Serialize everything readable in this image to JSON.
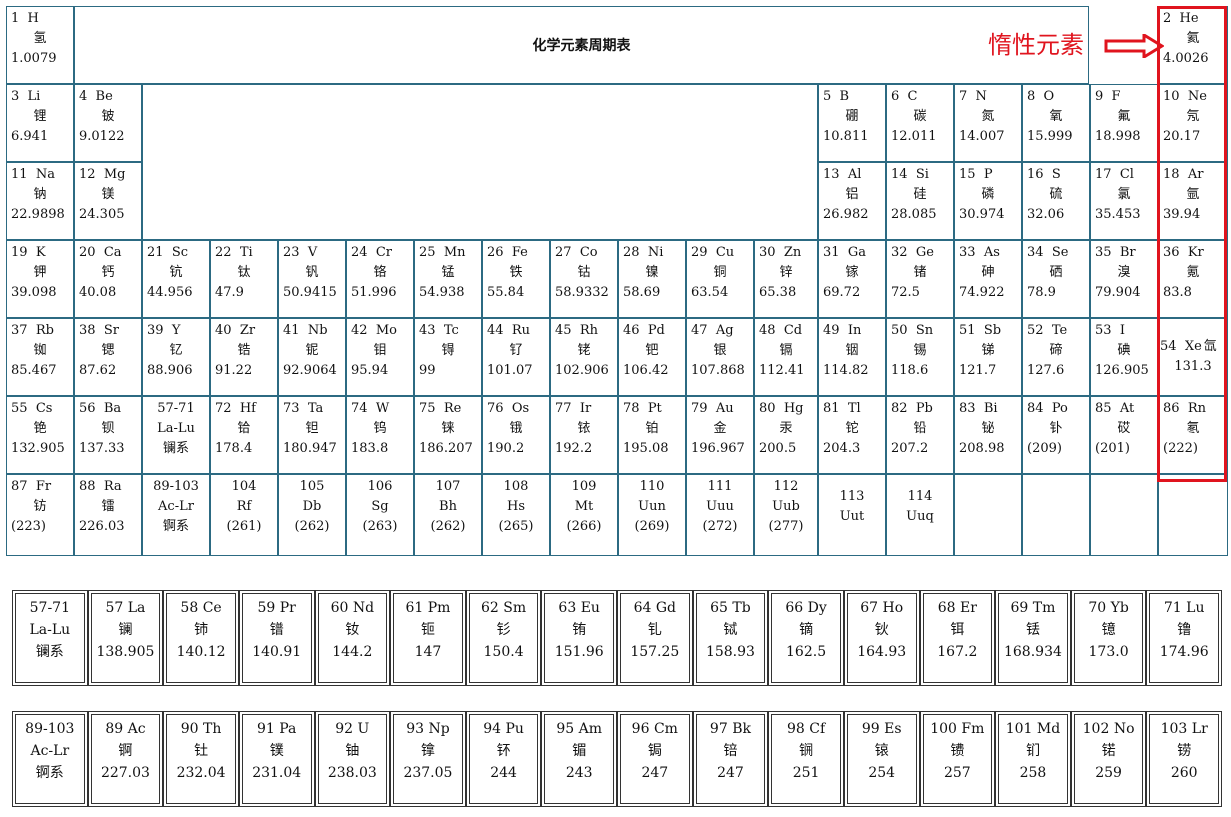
{
  "title": "化学元素周期表",
  "annotation": {
    "text": "惰性元素",
    "color": "#e0141e"
  },
  "main": [
    {
      "r": 0,
      "c": 0,
      "n": "1",
      "s": "H",
      "cn": "氢",
      "m": "1.0079"
    },
    {
      "r": 0,
      "c": 17,
      "n": "2",
      "s": "He",
      "cn": "氦",
      "m": "4.0026"
    },
    {
      "r": 1,
      "c": 0,
      "n": "3",
      "s": "Li",
      "cn": "锂",
      "m": "6.941"
    },
    {
      "r": 1,
      "c": 1,
      "n": "4",
      "s": "Be",
      "cn": "铍",
      "m": "9.0122"
    },
    {
      "r": 1,
      "c": 12,
      "n": "5",
      "s": "B",
      "cn": "硼",
      "m": "10.811"
    },
    {
      "r": 1,
      "c": 13,
      "n": "6",
      "s": "C",
      "cn": "碳",
      "m": "12.011"
    },
    {
      "r": 1,
      "c": 14,
      "n": "7",
      "s": "N",
      "cn": "氮",
      "m": "14.007"
    },
    {
      "r": 1,
      "c": 15,
      "n": "8",
      "s": "O",
      "cn": "氧",
      "m": "15.999"
    },
    {
      "r": 1,
      "c": 16,
      "n": "9",
      "s": "F",
      "cn": "氟",
      "m": "18.998"
    },
    {
      "r": 1,
      "c": 17,
      "n": "10",
      "s": "Ne",
      "cn": "氖",
      "m": "20.17"
    },
    {
      "r": 2,
      "c": 0,
      "n": "11",
      "s": "Na",
      "cn": "钠",
      "m": "22.9898"
    },
    {
      "r": 2,
      "c": 1,
      "n": "12",
      "s": "Mg",
      "cn": "镁",
      "m": "24.305"
    },
    {
      "r": 2,
      "c": 12,
      "n": "13",
      "s": "Al",
      "cn": "铝",
      "m": "26.982"
    },
    {
      "r": 2,
      "c": 13,
      "n": "14",
      "s": "Si",
      "cn": "硅",
      "m": "28.085"
    },
    {
      "r": 2,
      "c": 14,
      "n": "15",
      "s": "P",
      "cn": "磷",
      "m": "30.974"
    },
    {
      "r": 2,
      "c": 15,
      "n": "16",
      "s": "S",
      "cn": "硫",
      "m": "32.06"
    },
    {
      "r": 2,
      "c": 16,
      "n": "17",
      "s": "Cl",
      "cn": "氯",
      "m": "35.453"
    },
    {
      "r": 2,
      "c": 17,
      "n": "18",
      "s": "Ar",
      "cn": "氩",
      "m": "39.94"
    },
    {
      "r": 3,
      "c": 0,
      "n": "19",
      "s": "K",
      "cn": "钾",
      "m": "39.098"
    },
    {
      "r": 3,
      "c": 1,
      "n": "20",
      "s": "Ca",
      "cn": "钙",
      "m": "40.08"
    },
    {
      "r": 3,
      "c": 2,
      "n": "21",
      "s": "Sc",
      "cn": "钪",
      "m": "44.956"
    },
    {
      "r": 3,
      "c": 3,
      "n": "22",
      "s": "Ti",
      "cn": "钛",
      "m": "47.9"
    },
    {
      "r": 3,
      "c": 4,
      "n": "23",
      "s": "V",
      "cn": "钒",
      "m": "50.9415"
    },
    {
      "r": 3,
      "c": 5,
      "n": "24",
      "s": "Cr",
      "cn": "铬",
      "m": "51.996"
    },
    {
      "r": 3,
      "c": 6,
      "n": "25",
      "s": "Mn",
      "cn": "锰",
      "m": "54.938"
    },
    {
      "r": 3,
      "c": 7,
      "n": "26",
      "s": "Fe",
      "cn": "铁",
      "m": "55.84"
    },
    {
      "r": 3,
      "c": 8,
      "n": "27",
      "s": "Co",
      "cn": "钴",
      "m": "58.9332"
    },
    {
      "r": 3,
      "c": 9,
      "n": "28",
      "s": "Ni",
      "cn": "镍",
      "m": "58.69"
    },
    {
      "r": 3,
      "c": 10,
      "n": "29",
      "s": "Cu",
      "cn": "铜",
      "m": "63.54"
    },
    {
      "r": 3,
      "c": 11,
      "n": "30",
      "s": "Zn",
      "cn": "锌",
      "m": "65.38"
    },
    {
      "r": 3,
      "c": 12,
      "n": "31",
      "s": "Ga",
      "cn": "镓",
      "m": "69.72"
    },
    {
      "r": 3,
      "c": 13,
      "n": "32",
      "s": "Ge",
      "cn": "锗",
      "m": "72.5"
    },
    {
      "r": 3,
      "c": 14,
      "n": "33",
      "s": "As",
      "cn": "砷",
      "m": "74.922"
    },
    {
      "r": 3,
      "c": 15,
      "n": "34",
      "s": "Se",
      "cn": "硒",
      "m": "78.9"
    },
    {
      "r": 3,
      "c": 16,
      "n": "35",
      "s": "Br",
      "cn": "溴",
      "m": "79.904"
    },
    {
      "r": 3,
      "c": 17,
      "n": "36",
      "s": "Kr",
      "cn": "氪",
      "m": "83.8"
    },
    {
      "r": 4,
      "c": 0,
      "n": "37",
      "s": "Rb",
      "cn": "铷",
      "m": "85.467"
    },
    {
      "r": 4,
      "c": 1,
      "n": "38",
      "s": "Sr",
      "cn": "锶",
      "m": "87.62"
    },
    {
      "r": 4,
      "c": 2,
      "n": "39",
      "s": "Y",
      "cn": "钇",
      "m": "88.906"
    },
    {
      "r": 4,
      "c": 3,
      "n": "40",
      "s": "Zr",
      "cn": "锆",
      "m": "91.22"
    },
    {
      "r": 4,
      "c": 4,
      "n": "41",
      "s": "Nb",
      "cn": "铌",
      "m": "92.9064"
    },
    {
      "r": 4,
      "c": 5,
      "n": "42",
      "s": "Mo",
      "cn": "钼",
      "m": "95.94"
    },
    {
      "r": 4,
      "c": 6,
      "n": "43",
      "s": "Tc",
      "cn": "锝",
      "m": "99"
    },
    {
      "r": 4,
      "c": 7,
      "n": "44",
      "s": "Ru",
      "cn": "钌",
      "m": "101.07"
    },
    {
      "r": 4,
      "c": 8,
      "n": "45",
      "s": "Rh",
      "cn": "铑",
      "m": "102.906"
    },
    {
      "r": 4,
      "c": 9,
      "n": "46",
      "s": "Pd",
      "cn": "钯",
      "m": "106.42"
    },
    {
      "r": 4,
      "c": 10,
      "n": "47",
      "s": "Ag",
      "cn": "银",
      "m": "107.868"
    },
    {
      "r": 4,
      "c": 11,
      "n": "48",
      "s": "Cd",
      "cn": "镉",
      "m": "112.41"
    },
    {
      "r": 4,
      "c": 12,
      "n": "49",
      "s": "In",
      "cn": "铟",
      "m": "114.82"
    },
    {
      "r": 4,
      "c": 13,
      "n": "50",
      "s": "Sn",
      "cn": "锡",
      "m": "118.6"
    },
    {
      "r": 4,
      "c": 14,
      "n": "51",
      "s": "Sb",
      "cn": "锑",
      "m": "121.7"
    },
    {
      "r": 4,
      "c": 15,
      "n": "52",
      "s": "Te",
      "cn": "碲",
      "m": "127.6"
    },
    {
      "r": 4,
      "c": 16,
      "n": "53",
      "s": "I",
      "cn": "碘",
      "m": "126.905"
    },
    {
      "r": 4,
      "c": 17,
      "n": "54",
      "s": "Xe",
      "cn": "氙",
      "m": "131.3",
      "xe": true
    },
    {
      "r": 5,
      "c": 0,
      "n": "55",
      "s": "Cs",
      "cn": "铯",
      "m": "132.905"
    },
    {
      "r": 5,
      "c": 1,
      "n": "56",
      "s": "Ba",
      "cn": "钡",
      "m": "137.33"
    },
    {
      "r": 5,
      "c": 2,
      "n": "57-71",
      "s": "",
      "cn": "La-Lu",
      "m": "镧系"
    },
    {
      "r": 5,
      "c": 3,
      "n": "72",
      "s": "Hf",
      "cn": "铪",
      "m": "178.4"
    },
    {
      "r": 5,
      "c": 4,
      "n": "73",
      "s": "Ta",
      "cn": "钽",
      "m": "180.947"
    },
    {
      "r": 5,
      "c": 5,
      "n": "74",
      "s": "W",
      "cn": "钨",
      "m": "183.8"
    },
    {
      "r": 5,
      "c": 6,
      "n": "75",
      "s": "Re",
      "cn": "铼",
      "m": "186.207"
    },
    {
      "r": 5,
      "c": 7,
      "n": "76",
      "s": "Os",
      "cn": "锇",
      "m": "190.2"
    },
    {
      "r": 5,
      "c": 8,
      "n": "77",
      "s": "Ir",
      "cn": "铱",
      "m": "192.2"
    },
    {
      "r": 5,
      "c": 9,
      "n": "78",
      "s": "Pt",
      "cn": "铂",
      "m": "195.08"
    },
    {
      "r": 5,
      "c": 10,
      "n": "79",
      "s": "Au",
      "cn": "金",
      "m": "196.967"
    },
    {
      "r": 5,
      "c": 11,
      "n": "80",
      "s": "Hg",
      "cn": "汞",
      "m": "200.5"
    },
    {
      "r": 5,
      "c": 12,
      "n": "81",
      "s": "Tl",
      "cn": "铊",
      "m": "204.3"
    },
    {
      "r": 5,
      "c": 13,
      "n": "82",
      "s": "Pb",
      "cn": "铅",
      "m": "207.2"
    },
    {
      "r": 5,
      "c": 14,
      "n": "83",
      "s": "Bi",
      "cn": "铋",
      "m": "208.98"
    },
    {
      "r": 5,
      "c": 15,
      "n": "84",
      "s": "Po",
      "cn": "钋",
      "m": "(209)"
    },
    {
      "r": 5,
      "c": 16,
      "n": "85",
      "s": "At",
      "cn": "砹",
      "m": "(201)"
    },
    {
      "r": 5,
      "c": 17,
      "n": "86",
      "s": "Rn",
      "cn": "氡",
      "m": "(222)"
    },
    {
      "r": 6,
      "c": 0,
      "n": "87",
      "s": "Fr",
      "cn": "钫",
      "m": "(223)"
    },
    {
      "r": 6,
      "c": 1,
      "n": "88",
      "s": "Ra",
      "cn": "镭",
      "m": "226.03"
    },
    {
      "r": 6,
      "c": 2,
      "n": "89-103",
      "s": "",
      "cn": "Ac-Lr",
      "m": "锕系"
    },
    {
      "r": 6,
      "c": 3,
      "n": "104",
      "s": "",
      "cn": "Rf",
      "m": "(261)"
    },
    {
      "r": 6,
      "c": 4,
      "n": "105",
      "s": "",
      "cn": "Db",
      "m": "(262)"
    },
    {
      "r": 6,
      "c": 5,
      "n": "106",
      "s": "",
      "cn": "Sg",
      "m": "(263)"
    },
    {
      "r": 6,
      "c": 6,
      "n": "107",
      "s": "",
      "cn": "Bh",
      "m": "(262)"
    },
    {
      "r": 6,
      "c": 7,
      "n": "108",
      "s": "",
      "cn": "Hs",
      "m": "(265)"
    },
    {
      "r": 6,
      "c": 8,
      "n": "109",
      "s": "",
      "cn": "Mt",
      "m": "(266)"
    },
    {
      "r": 6,
      "c": 9,
      "n": "110",
      "s": "",
      "cn": "Uun",
      "m": "(269)"
    },
    {
      "r": 6,
      "c": 10,
      "n": "111",
      "s": "",
      "cn": "Uuu",
      "m": "(272)"
    },
    {
      "r": 6,
      "c": 11,
      "n": "112",
      "s": "",
      "cn": "Uub",
      "m": "(277)"
    },
    {
      "r": 6,
      "c": 12,
      "n": "113",
      "s": "",
      "cn": "Uut",
      "m": ""
    },
    {
      "r": 6,
      "c": 13,
      "n": "114",
      "s": "",
      "cn": "Uuq",
      "m": ""
    }
  ],
  "lanthanides": [
    {
      "n": "57-71",
      "s": "",
      "cn": "La-Lu",
      "m": "镧系"
    },
    {
      "n": "57",
      "s": "La",
      "cn": "镧",
      "m": "138.905"
    },
    {
      "n": "58",
      "s": "Ce",
      "cn": "铈",
      "m": "140.12"
    },
    {
      "n": "59",
      "s": "Pr",
      "cn": "镨",
      "m": "140.91"
    },
    {
      "n": "60",
      "s": "Nd",
      "cn": "钕",
      "m": "144.2"
    },
    {
      "n": "61",
      "s": "Pm",
      "cn": "钷",
      "m": "147"
    },
    {
      "n": "62",
      "s": "Sm",
      "cn": "钐",
      "m": "150.4"
    },
    {
      "n": "63",
      "s": "Eu",
      "cn": "铕",
      "m": "151.96"
    },
    {
      "n": "64",
      "s": "Gd",
      "cn": "钆",
      "m": "157.25"
    },
    {
      "n": "65",
      "s": "Tb",
      "cn": "铽",
      "m": "158.93"
    },
    {
      "n": "66",
      "s": "Dy",
      "cn": "镝",
      "m": "162.5"
    },
    {
      "n": "67",
      "s": "Ho",
      "cn": "钬",
      "m": "164.93"
    },
    {
      "n": "68",
      "s": "Er",
      "cn": "铒",
      "m": "167.2"
    },
    {
      "n": "69",
      "s": "Tm",
      "cn": "铥",
      "m": "168.934"
    },
    {
      "n": "70",
      "s": "Yb",
      "cn": "镱",
      "m": "173.0"
    },
    {
      "n": "71",
      "s": "Lu",
      "cn": "镥",
      "m": "174.96"
    }
  ],
  "actinides": [
    {
      "n": "89-103",
      "s": "",
      "cn": "Ac-Lr",
      "m": "锕系"
    },
    {
      "n": "89",
      "s": "Ac",
      "cn": "锕",
      "m": "227.03"
    },
    {
      "n": "90",
      "s": "Th",
      "cn": "钍",
      "m": "232.04"
    },
    {
      "n": "91",
      "s": "Pa",
      "cn": "镤",
      "m": "231.04"
    },
    {
      "n": "92",
      "s": "U",
      "cn": "铀",
      "m": "238.03"
    },
    {
      "n": "93",
      "s": "Np",
      "cn": "镎",
      "m": "237.05"
    },
    {
      "n": "94",
      "s": "Pu",
      "cn": "钚",
      "m": "244"
    },
    {
      "n": "95",
      "s": "Am",
      "cn": "镅",
      "m": "243"
    },
    {
      "n": "96",
      "s": "Cm",
      "cn": "锔",
      "m": "247"
    },
    {
      "n": "97",
      "s": "Bk",
      "cn": "锫",
      "m": "247"
    },
    {
      "n": "98",
      "s": "Cf",
      "cn": "锎",
      "m": "251"
    },
    {
      "n": "99",
      "s": "Es",
      "cn": "锿",
      "m": "254"
    },
    {
      "n": "100",
      "s": "Fm",
      "cn": "镄",
      "m": "257"
    },
    {
      "n": "101",
      "s": "Md",
      "cn": "钔",
      "m": "258"
    },
    {
      "n": "102",
      "s": "No",
      "cn": "锘",
      "m": "259"
    },
    {
      "n": "103",
      "s": "Lr",
      "cn": "铹",
      "m": "260"
    }
  ]
}
